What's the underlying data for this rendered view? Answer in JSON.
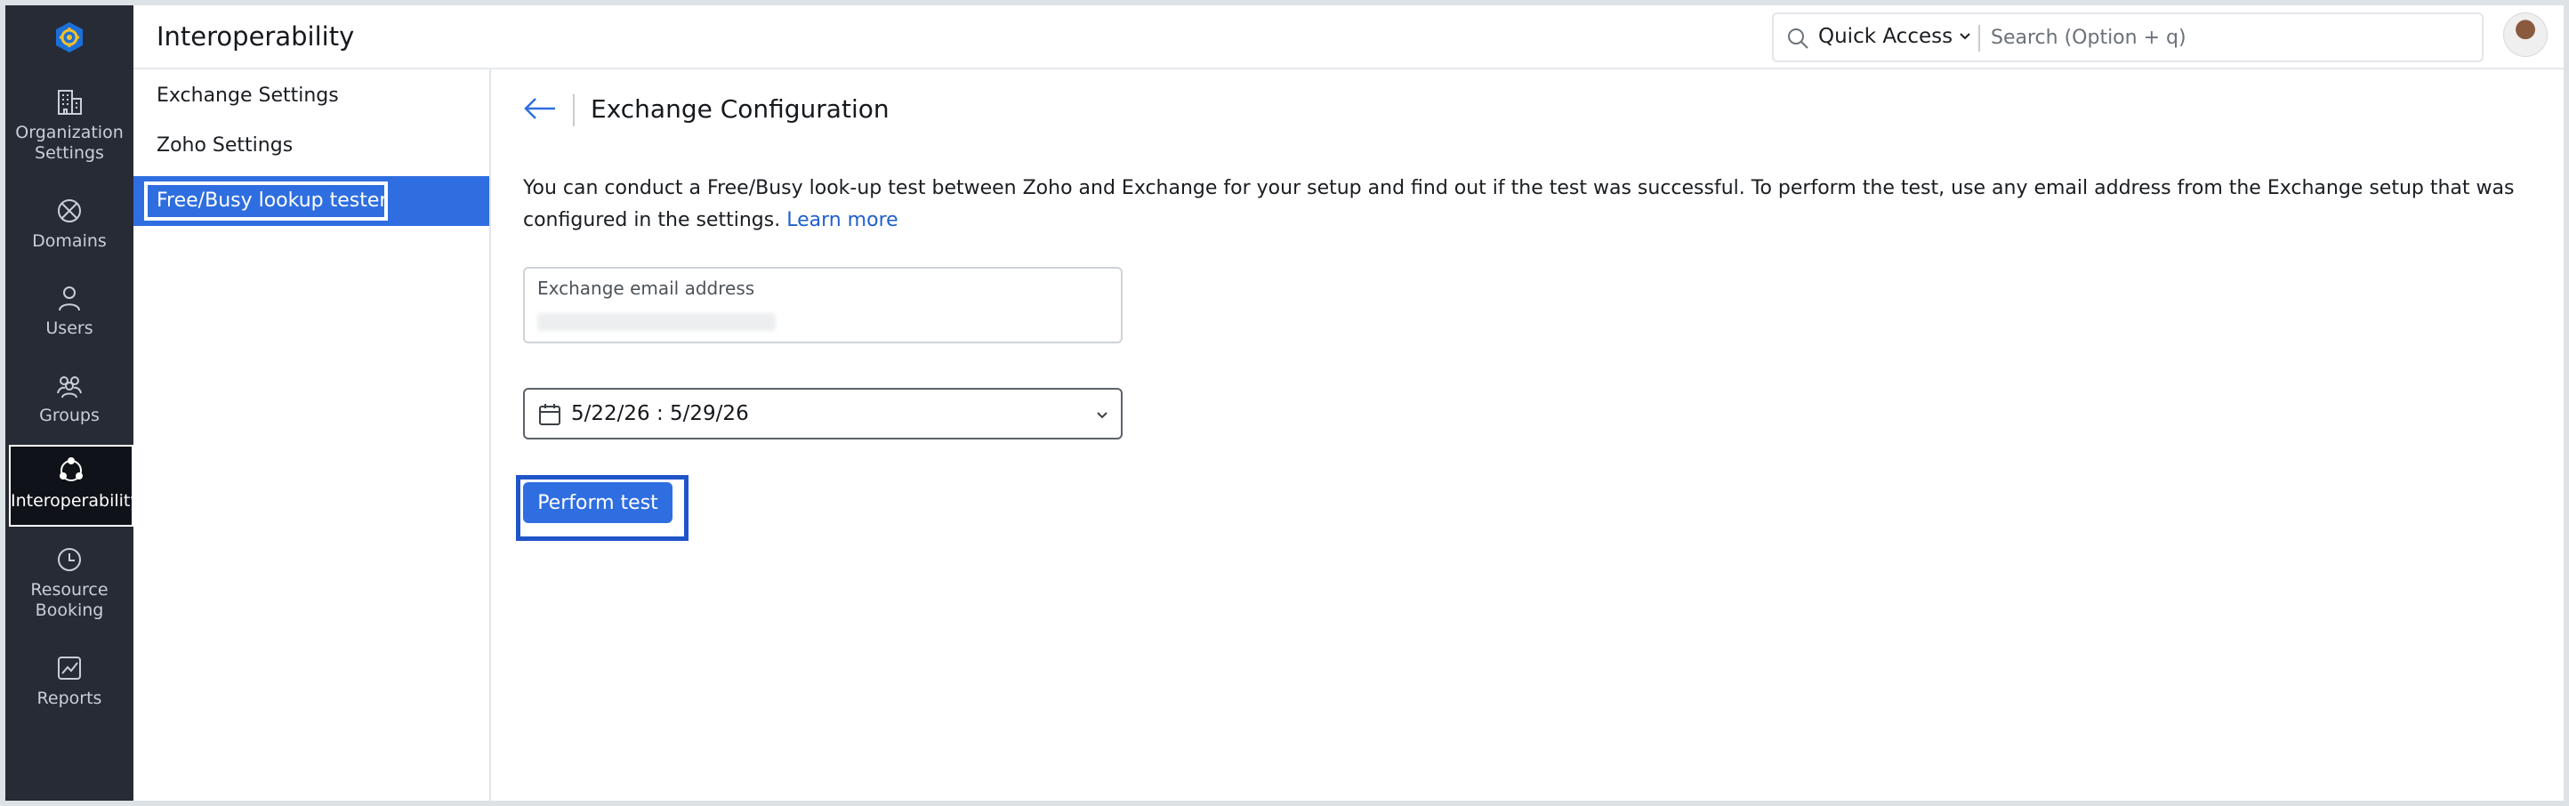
{
  "header": {
    "title": "Interoperability",
    "quick_access": "Quick Access",
    "search_placeholder": "Search (Option + q)"
  },
  "rail": {
    "items": [
      {
        "label": "Organization Settings",
        "icon": "building-icon"
      },
      {
        "label": "Domains",
        "icon": "globe-icon"
      },
      {
        "label": "Users",
        "icon": "user-icon"
      },
      {
        "label": "Groups",
        "icon": "group-icon"
      },
      {
        "label": "Interoperability",
        "icon": "interop-icon",
        "active": true
      },
      {
        "label": "Resource Booking",
        "icon": "clock-icon"
      },
      {
        "label": "Reports",
        "icon": "chart-icon"
      }
    ]
  },
  "subnav": {
    "items": [
      {
        "label": "Exchange Settings"
      },
      {
        "label": "Zoho Settings"
      },
      {
        "label": "Free/Busy lookup tester",
        "active": true
      }
    ]
  },
  "main": {
    "title": "Exchange Configuration",
    "description": "You can conduct a Free/Busy look-up test between Zoho and Exchange for your setup and find out if the test was successful. To perform the test, use any email address from the Exchange setup that was configured in the settings.",
    "learn_more": "Learn more",
    "email_label": "Exchange email address",
    "date_range": "5/22/26 : 5/29/26",
    "perform_button": "Perform test"
  },
  "colors": {
    "accent": "#2f6ee0",
    "rail_bg": "#262b35",
    "link": "#1f5fcf"
  }
}
